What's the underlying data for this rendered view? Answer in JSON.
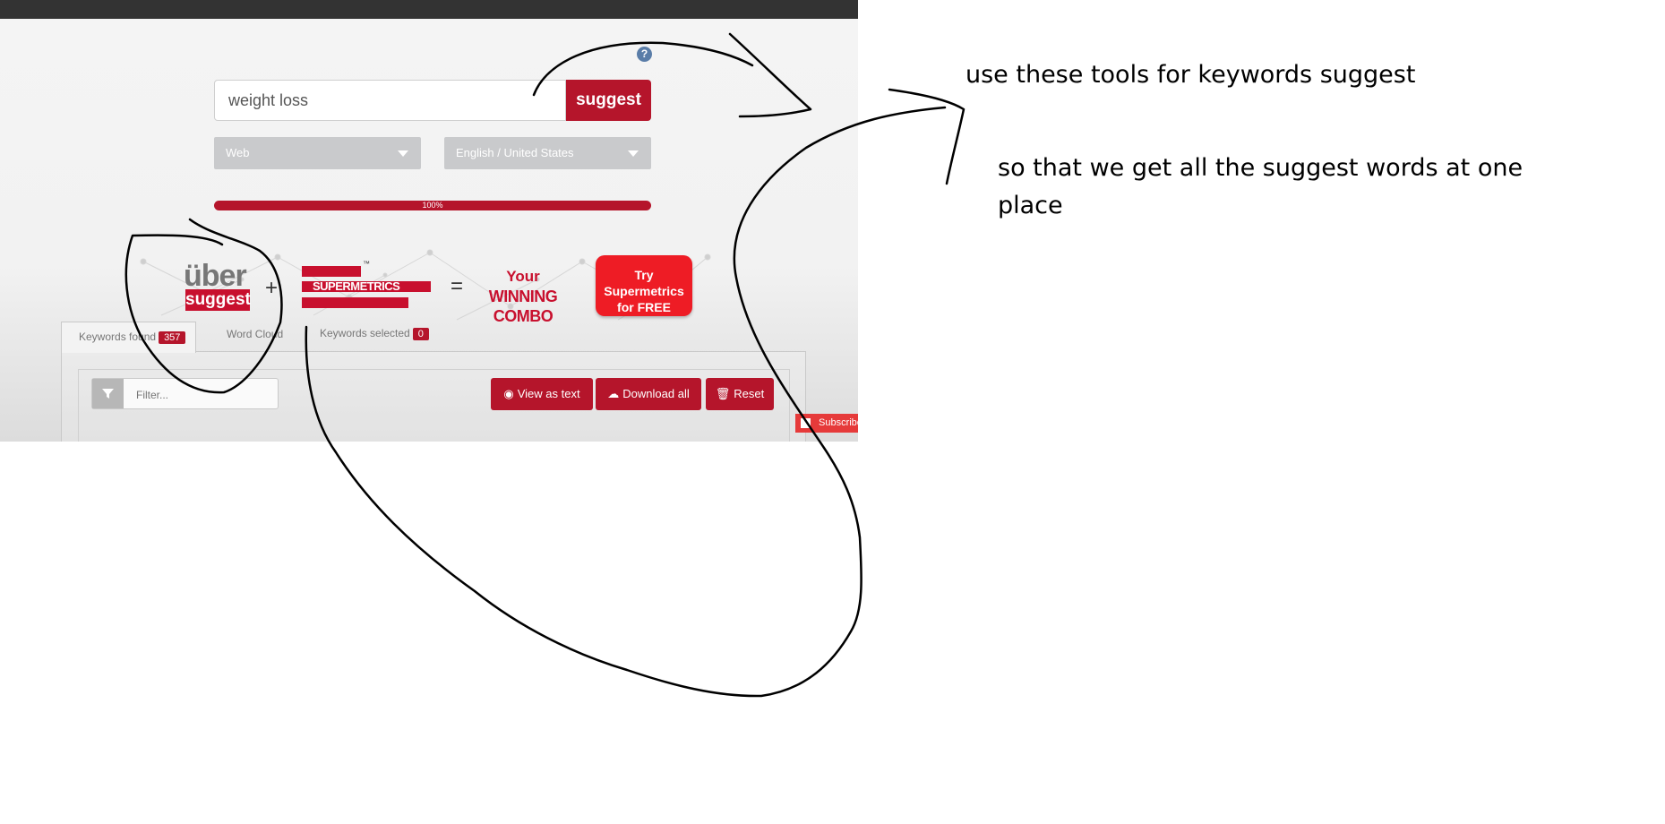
{
  "search": {
    "value": "weight loss",
    "button_label": "suggest"
  },
  "selects": {
    "source": "Web",
    "language": "English / United States"
  },
  "progress": {
    "label": "100%",
    "value": 1.0
  },
  "banner": {
    "uber_top": "über",
    "uber_bottom": "suggest",
    "plus": "+",
    "supermetrics": "SUPERMETRICS",
    "tm": "™",
    "equals": "=",
    "combo_line1": "Your",
    "combo_line2": "WINNING COMBO",
    "cta_line1": "Try Supermetrics",
    "cta_line2": "for FREE"
  },
  "tabs": [
    {
      "label": "Keywords found",
      "badge": "357"
    },
    {
      "label": "Word Cloud"
    },
    {
      "label": "Keywords selected",
      "badge": "0"
    }
  ],
  "filter": {
    "placeholder": "Filter..."
  },
  "actions": {
    "view_text": "View as text",
    "download_all": "Download all",
    "reset": "Reset"
  },
  "subscribe": "Subscribe",
  "help": "?",
  "annotations": {
    "line1": "use these tools for keywords suggest",
    "line2": "so that we get all the suggest words at one",
    "line3": "place"
  },
  "colors": {
    "brand_red": "#b5152b",
    "cta_red": "#ee1c25",
    "topbar": "#333333"
  }
}
